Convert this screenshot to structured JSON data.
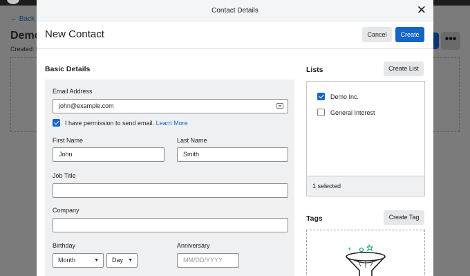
{
  "background": {
    "back_label": "← Back to",
    "title": "Demo",
    "created": "Created: F"
  },
  "modal": {
    "window_title": "Contact Details",
    "heading": "New Contact",
    "cancel_label": "Cancel",
    "create_label": "Create",
    "basic": {
      "title": "Basic Details",
      "email_label": "Email Address",
      "email_value": "john@example.com",
      "permission_text": "I have permission to send email.",
      "learn_more": "Learn More",
      "first_name_label": "First Name",
      "first_name_value": "John",
      "last_name_label": "Last Name",
      "last_name_value": "Smith",
      "job_title_label": "Job Title",
      "job_title_value": "",
      "company_label": "Company",
      "company_value": "",
      "birthday_label": "Birthday",
      "month_value": "Month",
      "day_value": "Day",
      "anniversary_label": "Anniversary",
      "anniversary_placeholder": "MM/DD/YYYY"
    },
    "lists": {
      "title": "Lists",
      "create_list_label": "Create List",
      "items": [
        {
          "label": "Demo Inc.",
          "checked": true
        },
        {
          "label": "General Interest",
          "checked": false
        }
      ],
      "selected_count": "1 selected"
    },
    "tags": {
      "title": "Tags",
      "create_tag_label": "Create Tag"
    }
  }
}
